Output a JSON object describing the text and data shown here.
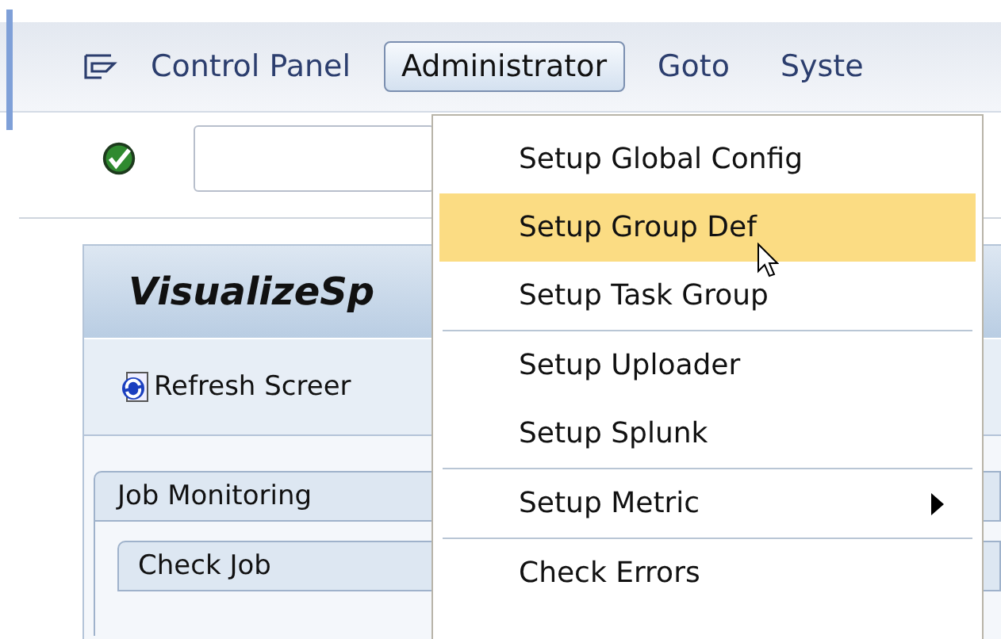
{
  "menu_bar": {
    "items": [
      {
        "label": "Control Panel",
        "selected": false
      },
      {
        "label": "Administrator",
        "selected": true
      },
      {
        "label": "Goto",
        "selected": false
      },
      {
        "label": "Syste",
        "selected": false
      }
    ]
  },
  "dropdown": {
    "items": [
      {
        "label": "Setup Global Config",
        "selected": false,
        "submenu": false,
        "divider_after": false
      },
      {
        "label": "Setup Group Def",
        "selected": true,
        "submenu": false,
        "divider_after": false
      },
      {
        "label": "Setup Task Group",
        "selected": false,
        "submenu": false,
        "divider_after": true
      },
      {
        "label": "Setup Uploader",
        "selected": false,
        "submenu": false,
        "divider_after": false
      },
      {
        "label": "Setup Splunk",
        "selected": false,
        "submenu": false,
        "divider_after": true
      },
      {
        "label": "Setup Metric",
        "selected": false,
        "submenu": true,
        "divider_after": true
      },
      {
        "label": "Check Errors",
        "selected": false,
        "submenu": false,
        "divider_after": false
      }
    ]
  },
  "panel": {
    "title": "VisualizeSp",
    "toolbar_button": "Refresh Screer"
  },
  "tabs": [
    {
      "label": "Job Monitoring"
    },
    {
      "label": "Check Job"
    }
  ]
}
